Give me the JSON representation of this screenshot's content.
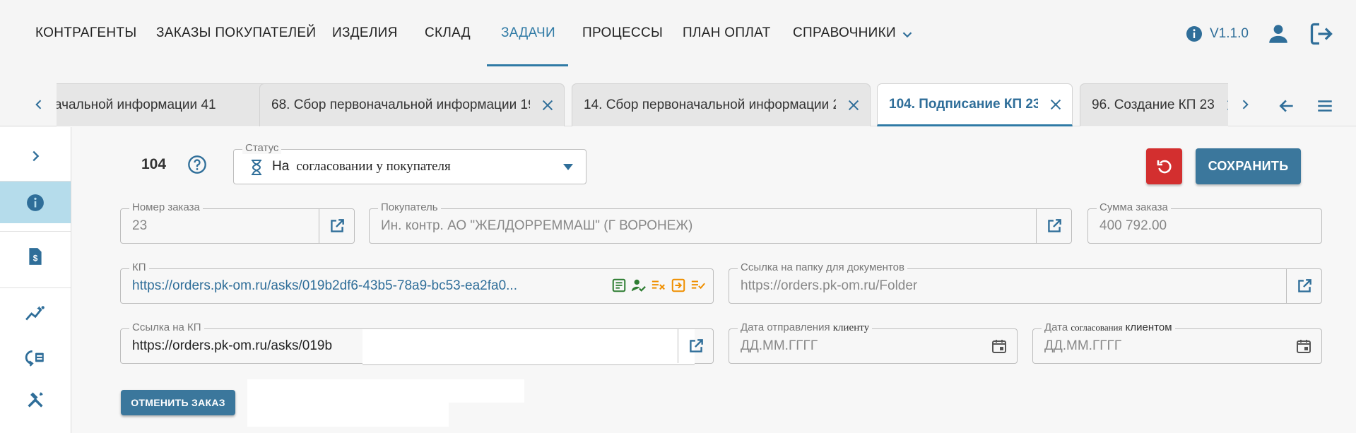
{
  "nav": {
    "items": [
      {
        "label": "КОНТРАГЕНТЫ"
      },
      {
        "label": "ЗАКАЗЫ ПОКУПАТЕЛЕЙ"
      },
      {
        "label": "ИЗДЕЛИЯ"
      },
      {
        "label": "СКЛАД"
      },
      {
        "label": "ЗАДАЧИ",
        "active": true
      },
      {
        "label": "ПРОЦЕССЫ"
      },
      {
        "label": "ПЛАН ОПЛАТ"
      },
      {
        "label": "СПРАВОЧНИКИ"
      }
    ],
    "version": "V1.1.0"
  },
  "tabs": [
    {
      "label": "ачальной информации 41"
    },
    {
      "label": "68. Сбор первоначальной информации 19"
    },
    {
      "label": "14. Сбор первоначальной информации 2"
    },
    {
      "label": "104. Подписание КП 23",
      "active": true
    },
    {
      "label": "96. Создание КП 23"
    }
  ],
  "sidebar": {
    "items": [
      "chevron-right-icon",
      "info-icon",
      "invoice-icon",
      "analytics-icon",
      "process-icon",
      "tools-icon"
    ]
  },
  "task": {
    "number": "104",
    "status": {
      "label": "Статус",
      "value_prefix": "На",
      "value_rest": "согласовании у покупателя"
    }
  },
  "buttons": {
    "save": "СОХРАНИТЬ",
    "cancel_order": "ОТМЕНИТЬ ЗАКАЗ"
  },
  "fields": {
    "order_number": {
      "label": "Номер заказа",
      "value": "23"
    },
    "buyer": {
      "label": "Покупатель",
      "value": "Ин. контр. АО \"ЖЕЛДОРРЕММАШ\" (Г ВОРОНЕЖ)"
    },
    "order_sum": {
      "label": "Сумма заказа",
      "value": "400 792.00"
    },
    "kp": {
      "label": "КП",
      "value": "https://orders.pk-om.ru/asks/019b2df6-43b5-78a9-bc53-ea2fa0..."
    },
    "folder_link": {
      "label": "Ссылка на папку для документов",
      "placeholder": "https://orders.pk-om.ru/Folder"
    },
    "kp_link": {
      "label": "Ссылка на КП",
      "value": "https://orders.pk-om.ru/asks/019b"
    },
    "sent_date": {
      "label_main": "Дата отправления",
      "label_extra": "клиенту",
      "placeholder": "ДД.ММ.ГГГГ"
    },
    "approval_date": {
      "label_main": "Дата",
      "label_mid": "согласования",
      "label_end": "клиентом",
      "placeholder": "ДД.ММ.ГГГГ"
    }
  },
  "colors": {
    "accent": "#2f7aa5",
    "button": "#3b779c",
    "danger": "#d32f2f",
    "icon_green": "#2e7d32",
    "icon_orange": "#ef8f00"
  }
}
